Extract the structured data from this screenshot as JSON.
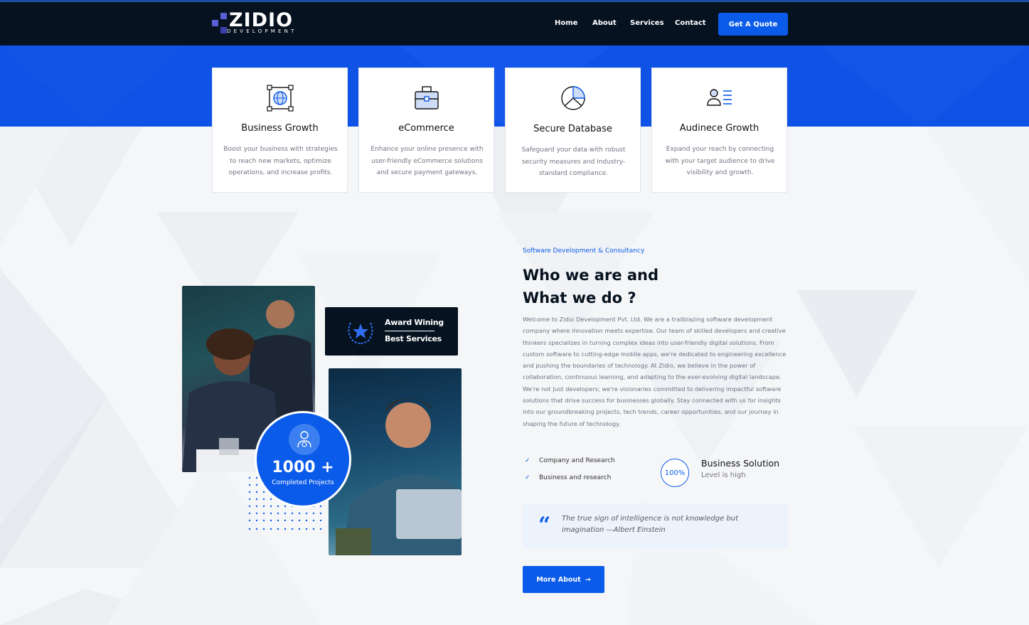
{
  "brand": {
    "name": "ZIDIO",
    "tagline": "DEVELOPMENT"
  },
  "nav": [
    {
      "label": "Home"
    },
    {
      "label": "About"
    },
    {
      "label": "Services"
    },
    {
      "label": "Contact"
    }
  ],
  "header": {
    "cta_label": "Get A Quote"
  },
  "features": [
    {
      "title": "Business Growth",
      "icon": "globe-frame-icon",
      "desc": "Boost your business with strategies to reach new markets, optimize operations, and increase profits."
    },
    {
      "title": "eCommerce",
      "icon": "briefcase-icon",
      "desc": "Enhance your online presence with user-friendly eCommerce solutions and secure payment gateways."
    },
    {
      "title": "Secure Database",
      "icon": "pie-chart-icon",
      "desc": "Safeguard your data with robust security measures and industry-standard compliance."
    },
    {
      "title": "Audinece Growth",
      "icon": "user-list-icon",
      "desc": "Expand your reach by connecting with your target audience to drive visibility and growth."
    }
  ],
  "collage": {
    "award_line1": "Award Wining",
    "award_line2": "Best Services",
    "projects_count": "1000 +",
    "projects_label": "Completed Projects"
  },
  "about": {
    "eyebrow": "Software Development & Consultancy",
    "heading_line1": "Who we are and",
    "heading_line2": "What we do ?",
    "paragraph": "Welcome to Zidio Development Pvt. Ltd. We are a trailblazing software development company where innovation meets expertise. Our team of skilled developers and creative thinkers specializes in turning complex ideas into user-friendly digital solutions. From custom software to cutting-edge mobile apps, we're dedicated to engineering excellence and pushing the boundaries of technology. At Zidio, we believe in the power of collaboration, continuous learning, and adapting to the ever-evolving digital landscape. We're not just developers; we're visionaries committed to delivering impactful software solutions that drive success for businesses globally. Stay connected with us for insights into our groundbreaking projects, tech trends, career opportunities, and our journey in shaping the future of technology.",
    "checks": [
      "Company and Research",
      "Business and research"
    ],
    "badge_value": "100%",
    "badge_title": "Business Solution",
    "badge_sub": "Level is high",
    "quote": "The true sign of intelligence is not knowledge but imagination",
    "quote_author": "Albert Einstein",
    "button_label": "More About"
  },
  "colors": {
    "accent": "#0b5bea",
    "band": "#0e52e6",
    "dark": "#06121f"
  }
}
